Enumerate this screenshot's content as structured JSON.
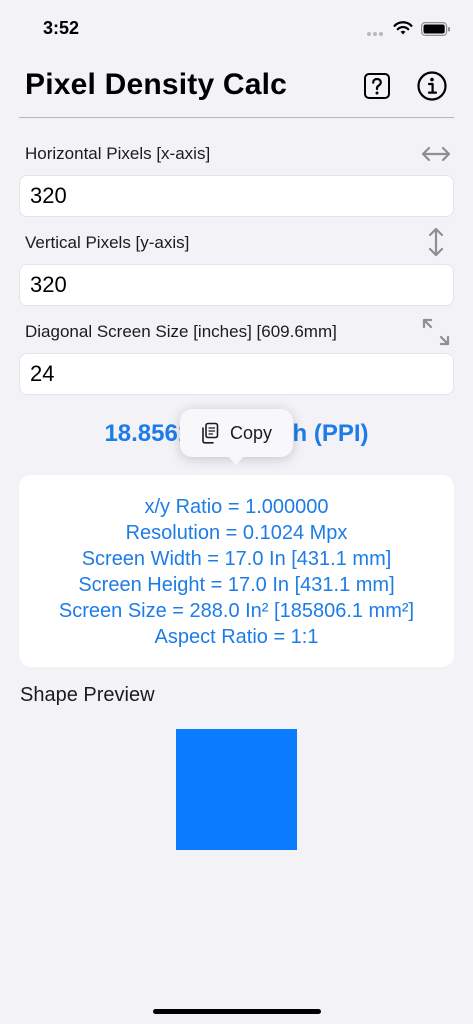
{
  "status_bar": {
    "time": "3:52"
  },
  "header": {
    "title": "Pixel Density Calc",
    "help_icon": "question-mark-square-icon",
    "info_icon": "info-circle-icon"
  },
  "fields": [
    {
      "label": "Horizontal Pixels  [x-axis]",
      "value": "320",
      "icon": "horizontal-arrows-icon"
    },
    {
      "label": "Vertical Pixels [y-axis]",
      "value": "320",
      "icon": "vertical-arrows-icon"
    },
    {
      "label": "Diagonal Screen Size [inches] [609.6mm]",
      "value": "24",
      "icon": "diagonal-arrows-icon"
    }
  ],
  "result": {
    "ppi_left": "18.85618",
    "ppi_right": "nch (PPI)"
  },
  "copy_menu": {
    "label": "Copy",
    "icon": "copy-icon"
  },
  "stats": [
    "x/y Ratio = 1.000000",
    "Resolution = 0.1024 Mpx",
    "Screen Width = 17.0 In [431.1 mm]",
    "Screen Height = 17.0 In [431.1 mm]",
    "Screen Size = 288.0 In² [185806.1 mm²]",
    "Aspect Ratio = 1:1"
  ],
  "preview": {
    "label": "Shape Preview",
    "color": "#0a7cff"
  },
  "colors": {
    "accent": "#1e7ce6",
    "background": "#f2f2f7"
  }
}
